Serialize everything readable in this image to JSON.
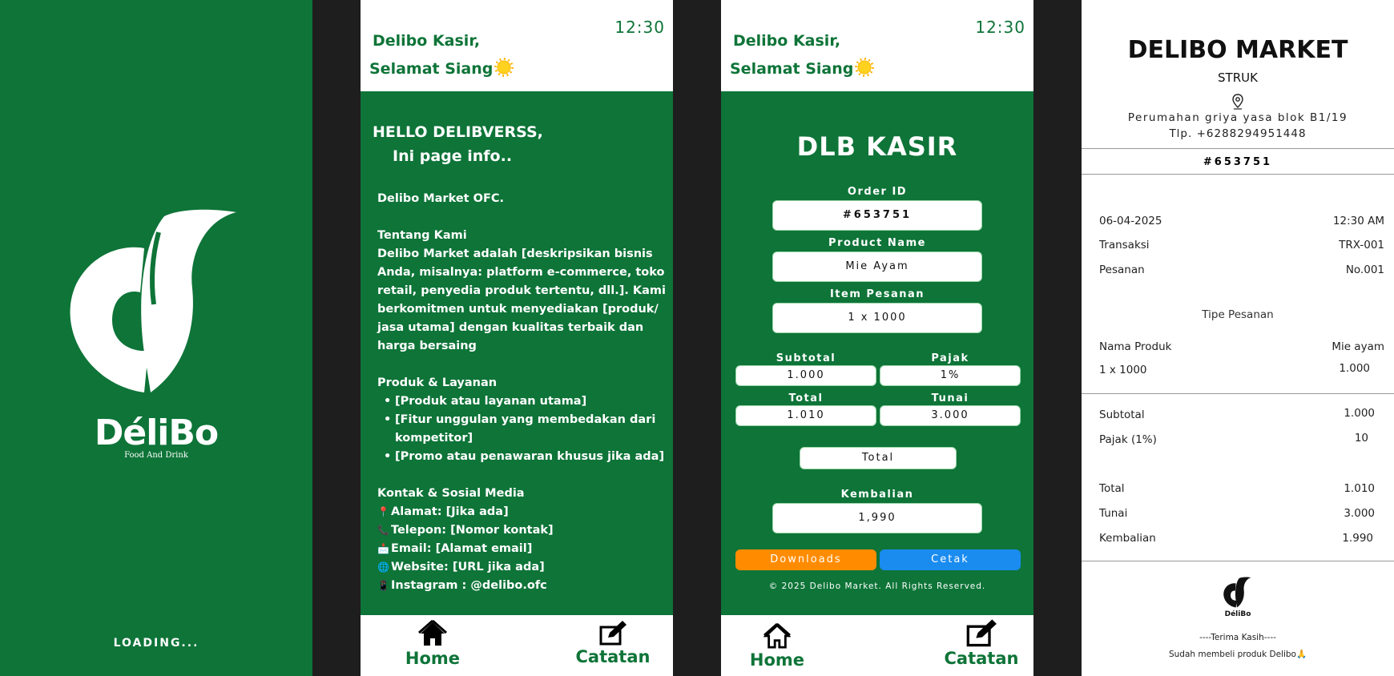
{
  "colors": {
    "brand_green": "#0e7438",
    "download_orange": "#ff8c00",
    "print_blue": "#1a8cf0",
    "separator": "#1e1e1e"
  },
  "splash": {
    "brand": "DéliBo",
    "tagline": "Food And Drink",
    "loading": "LOADING..."
  },
  "header": {
    "time": "12:30",
    "greeting_line1": "Delibo Kasir,",
    "greeting_line2": "Selamat Siang"
  },
  "nav": {
    "home": "Home",
    "notes": "Catatan"
  },
  "info": {
    "hello": "HELLO DELIBVERSS,",
    "subtitle": "Ini page info..",
    "company": "Delibo Market OFC.",
    "about_title": "Tentang Kami",
    "about_text": "Delibo Market adalah [deskripsikan bisnis Anda, misalnya: platform e-commerce, toko retail, penyedia produk tertentu, dll.]. Kami berkomitmen untuk menyediakan [produk/ jasa utama] dengan kualitas terbaik dan harga bersaing",
    "products_title": "Produk & Layanan",
    "products": [
      "[Produk atau layanan utama]",
      "[Fitur unggulan yang membedakan dari kompetitor]",
      "[Promo atau penawaran khusus jika ada]"
    ],
    "contact_title": "Kontak & Sosial Media",
    "contacts": [
      {
        "icon": "📍",
        "text": "Alamat: [Jika ada]"
      },
      {
        "icon": "📞",
        "text": "Telepon: [Nomor kontak]"
      },
      {
        "icon": "📩",
        "text": "Email: [Alamat email]"
      },
      {
        "icon": "🌐",
        "text": "Website: [URL jika ada]"
      },
      {
        "icon": "📱",
        "text": "Instagram : @delibo.ofc"
      }
    ]
  },
  "kasir": {
    "title": "DLB KASIR",
    "order_id_label": "Order ID",
    "order_id": "#653751",
    "product_label": "Product Name",
    "product": "Mie Ayam",
    "item_label": "Item Pesanan",
    "item": "1 x 1000",
    "subtotal_label": "Subtotal",
    "subtotal": "1.000",
    "pajak_label": "Pajak",
    "pajak": "1%",
    "total_label": "Total",
    "total": "1.010",
    "tunai_label": "Tunai",
    "tunai": "3.000",
    "total_button": "Total",
    "kembalian_label": "Kembalian",
    "kembalian": "1,990",
    "downloads": "Downloads",
    "cetak": "Cetak",
    "copyright": "© 2025 Delibo Market. All Rights Reserved."
  },
  "receipt": {
    "store": "DELIBO MARKET",
    "subtitle": "STRUK",
    "address": "Perumahan griya yasa blok B1/19",
    "phone": "Tlp. +6288294951448",
    "order_id": "#653751",
    "date": "06-04-2025",
    "time": "12:30 AM",
    "transaksi_label": "Transaksi",
    "transaksi": "TRX-001",
    "pesanan_label": "Pesanan",
    "pesanan": "No.001",
    "tipe_label": "Tipe Pesanan",
    "nama_produk_label": "Nama Produk",
    "nama_produk": "Mie ayam",
    "qty": "1 x 1000",
    "qty_value": "1.000",
    "subtotal_label": "Subtotal",
    "subtotal": "1.000",
    "pajak_label": "Pajak (1%)",
    "pajak": "10",
    "total_label": "Total",
    "total": "1.010",
    "tunai_label": "Tunai",
    "tunai": "3.000",
    "kembalian_label": "Kembalian",
    "kembalian": "1.990",
    "thanks": "----Terima Kasih----",
    "thanks2": "Sudah membeli produk Delibo🙏"
  }
}
